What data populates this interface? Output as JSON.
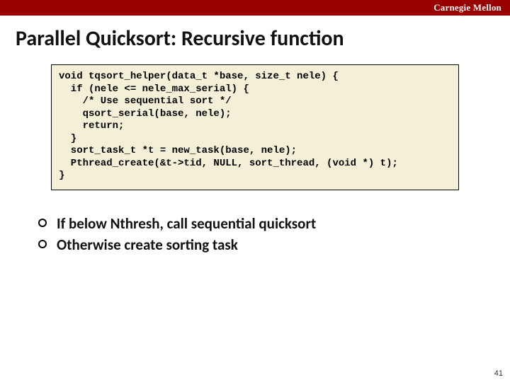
{
  "header": {
    "brand": "Carnegie Mellon"
  },
  "slide": {
    "title": "Parallel Quicksort: Recursive function",
    "code": "void tqsort_helper(data_t *base, size_t nele) {\n  if (nele <= nele_max_serial) {\n    /* Use sequential sort */\n    qsort_serial(base, nele);\n    return;\n  }\n  sort_task_t *t = new_task(base, nele);\n  Pthread_create(&t->tid, NULL, sort_thread, (void *) t);\n}",
    "bullets": [
      "If below Nthresh, call sequential quicksort",
      "Otherwise create sorting task"
    ],
    "page_number": "41"
  }
}
